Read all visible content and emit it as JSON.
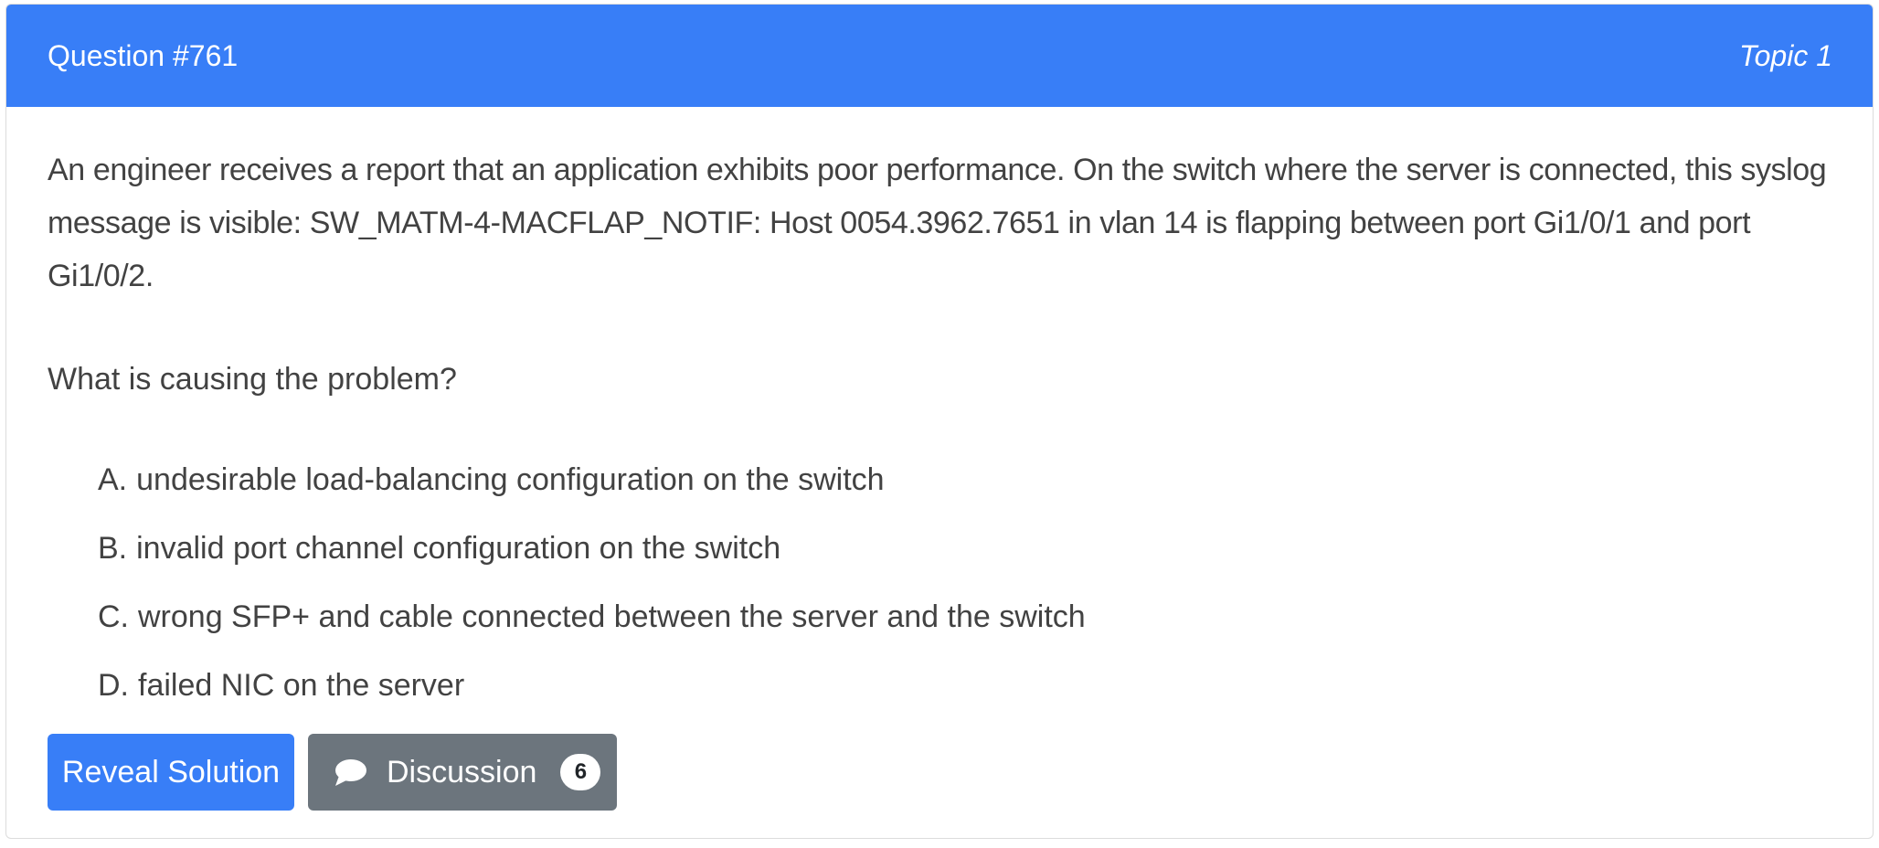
{
  "header": {
    "question_label": "Question #761",
    "topic_label": "Topic 1"
  },
  "question": {
    "line1": "An engineer receives a report that an application exhibits poor performance. On the switch where the server is connected, this syslog",
    "line2": "message is visible: SW_MATM-4-MACFLAP_NOTIF: Host 0054.3962.7651 in vlan 14 is flapping between port Gi1/0/1 and port Gi1/0/2.",
    "ask": "What is causing the problem?"
  },
  "choices": [
    {
      "letter": "A.",
      "text": "undesirable load-balancing configuration on the switch"
    },
    {
      "letter": "B.",
      "text": "invalid port channel configuration on the switch"
    },
    {
      "letter": "C.",
      "text": "wrong SFP+ and cable connected between the server and the switch"
    },
    {
      "letter": "D.",
      "text": "failed NIC on the server"
    }
  ],
  "actions": {
    "reveal_label": "Reveal Solution",
    "discussion_label": "Discussion",
    "discussion_count": "6",
    "discussion_icon": "comment-icon"
  },
  "colors": {
    "header_bg": "#387ef7",
    "reveal_bg": "#387ef7",
    "discussion_bg": "#6c757d"
  }
}
